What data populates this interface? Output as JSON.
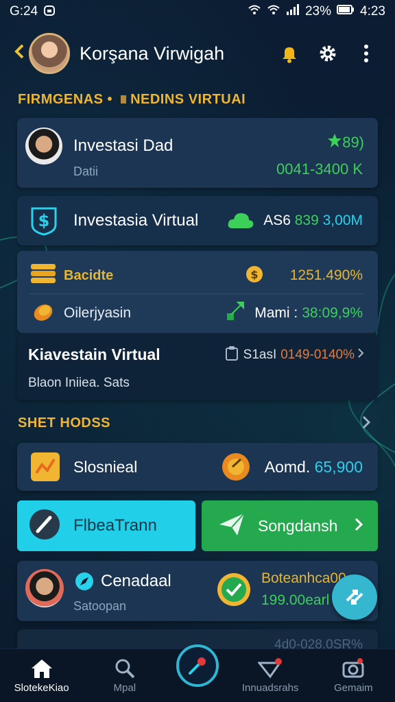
{
  "status_bar": {
    "time_left": "G:24",
    "battery_percent": "23%",
    "time_right": "4:23",
    "icons": [
      "alarm-icon",
      "wifi-icon",
      "signal-icon",
      "battery-icon"
    ]
  },
  "header": {
    "title": "Korşana Virwigah",
    "icons": [
      "chevron-left-icon",
      "profile-avatar",
      "bell-icon",
      "gear-icon",
      "kebab-menu-icon"
    ]
  },
  "section1": {
    "label_left": "FIRMGENAS",
    "label_right": "NEDINS VIRTUAI"
  },
  "card_investasi": {
    "title": "Investasi Dad",
    "subtitle": "Datii",
    "badge": "89)",
    "value": "0041-3400 K"
  },
  "card_virtual": {
    "title": "Investasia Virtual",
    "value_prefix": "AS6",
    "value_green": "839",
    "value_blue": "3,00M"
  },
  "card_stats": {
    "row1": {
      "label": "Bacidte",
      "value": "1251.490%"
    },
    "row2": {
      "label": "Oilerjyasin",
      "value_prefix": "Mami :",
      "value": "38:09,9%"
    }
  },
  "card_kiavestain": {
    "title": "Kiavestain Virtual",
    "meta_prefix": "S1asI",
    "meta_value": "0149-0140%",
    "subtitle": "Blaon Iniiea. Sats"
  },
  "section2": {
    "label": "SHET HODSS"
  },
  "card_slosnieal": {
    "label": "Slosnieal",
    "value_prefix": "Aomd.",
    "value": "65,900"
  },
  "buttons": {
    "left": "FlbeaTrann",
    "right": "Songdansh"
  },
  "card_cenadaal": {
    "title": "Cenadaal",
    "subtitle": "Satoopan",
    "right_title": "Boteanhca00",
    "right_value": "199.00earl"
  },
  "card_partial": {
    "value": "4d0-028.0SR%"
  },
  "bottom_nav": {
    "items": [
      {
        "label": "SlotekeKiao",
        "icon": "home-icon",
        "active": true
      },
      {
        "label": "Mpal",
        "icon": "search-icon",
        "active": false
      },
      {
        "label": "",
        "icon": "pin-icon",
        "active": false
      },
      {
        "label": "Innuadsrahs",
        "icon": "paper-plane-icon",
        "active": false
      },
      {
        "label": "Gemaim",
        "icon": "camera-icon",
        "active": false
      }
    ]
  },
  "colors": {
    "background": "#0b1a2e",
    "card": "#1b3552",
    "accent_gold": "#f0b531",
    "accent_green": "#3ccf5a",
    "accent_cyan": "#2ad1ea",
    "button_green": "#24a94e"
  }
}
